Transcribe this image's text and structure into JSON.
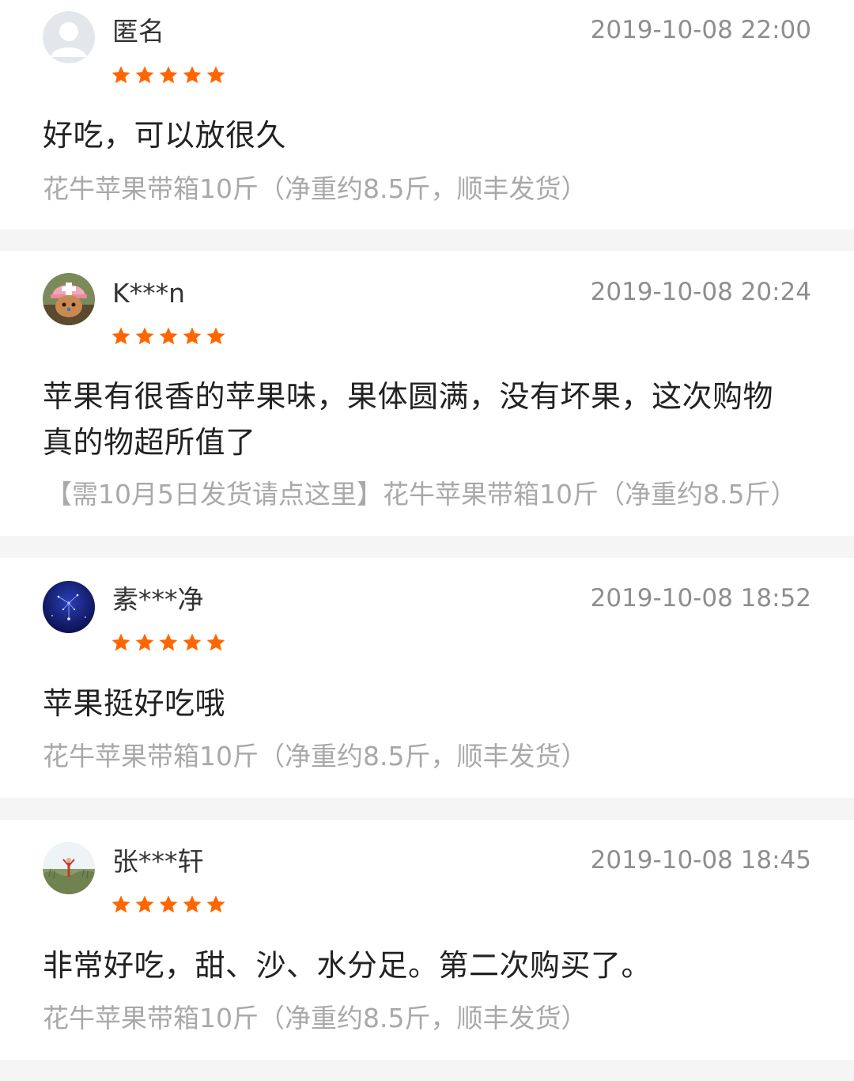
{
  "colors": {
    "star": "#ff6600",
    "page_background": "#f5f5f5",
    "card_background": "#ffffff",
    "timestamp": "#8e8e8e",
    "product_text": "#a9a9a9"
  },
  "reviews": [
    {
      "user": "匿名",
      "avatar": "default-avatar-icon",
      "time": "2019-10-08 22:00",
      "rating": 5,
      "comment": "好吃，可以放很久",
      "product": "花牛苹果带箱10斤（净重约8.5斤，顺丰发货）"
    },
    {
      "user": "K***n",
      "avatar": "chopper-avatar",
      "time": "2019-10-08 20:24",
      "rating": 5,
      "comment": "苹果有很香的苹果味，果体圆满，没有坏果，这次购物真的物超所值了",
      "product": "【需10月5日发货请点这里】花牛苹果带箱10斤（净重约8.5斤）"
    },
    {
      "user": "素***净",
      "avatar": "night-sky-avatar",
      "time": "2019-10-08 18:52",
      "rating": 5,
      "comment": "苹果挺好吃哦",
      "product": "花牛苹果带箱10斤（净重约8.5斤，顺丰发货）"
    },
    {
      "user": "张***轩",
      "avatar": "field-photo-avatar",
      "time": "2019-10-08 18:45",
      "rating": 5,
      "comment": "非常好吃，甜、沙、水分足。第二次购买了。",
      "product": "花牛苹果带箱10斤（净重约8.5斤，顺丰发货）"
    }
  ]
}
